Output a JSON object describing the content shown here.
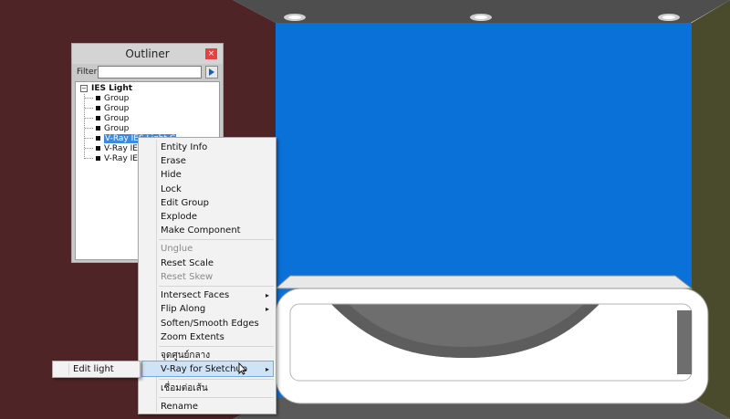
{
  "outliner": {
    "title": "Outliner",
    "close_glyph": "×",
    "filter_label": "Filter:",
    "filter_value": "",
    "root": {
      "expander": "−",
      "label": "IES Light"
    },
    "items": [
      {
        "label": "Group"
      },
      {
        "label": "Group"
      },
      {
        "label": "Group"
      },
      {
        "label": "Group"
      },
      {
        "label": "V-Ray IES Light C",
        "selected": true
      },
      {
        "label": "V-Ray IES Li"
      },
      {
        "label": "V-Ray IES Li"
      }
    ]
  },
  "context_menu": {
    "entity_info": "Entity Info",
    "erase": "Erase",
    "hide": "Hide",
    "lock": "Lock",
    "edit_group": "Edit Group",
    "explode": "Explode",
    "make_component": "Make Component",
    "unglue": "Unglue",
    "reset_scale": "Reset Scale",
    "reset_skew": "Reset Skew",
    "intersect_faces": "Intersect Faces",
    "flip_along": "Flip Along",
    "soften_smooth": "Soften/Smooth Edges",
    "zoom_extents": "Zoom Extents",
    "thai_center": "จุดศูนย์กลาง",
    "vray": "V-Ray for Sketchup",
    "thai_connect": "เชื่อมต่อเส้น",
    "rename": "Rename",
    "arrow": "▸"
  },
  "submenu": {
    "edit_light": "Edit light"
  },
  "colors": {
    "left_wall": "#4f2426",
    "back_wall": "#0a71d9",
    "right_wall": "#4a4b2c",
    "ceiling": "#4e4e4e",
    "selection": "#3b8be0",
    "menu_highlight": "#cfe3f6"
  },
  "icons": [
    "close-icon",
    "filter-arrow-icon",
    "submenu-arrow-icon",
    "mouse-cursor-icon",
    "ceiling-light-icon"
  ]
}
